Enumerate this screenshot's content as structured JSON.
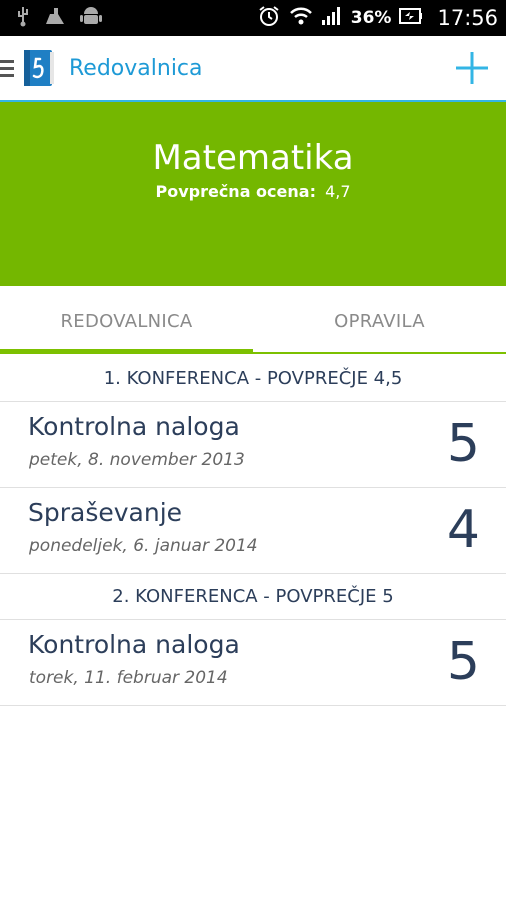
{
  "status_bar": {
    "icons_left": [
      "usb-icon",
      "notification-icon",
      "android-debug-icon"
    ],
    "icons_right": [
      "alarm-icon",
      "wifi-icon",
      "signal-icon",
      "battery-icon"
    ],
    "battery": "36%",
    "time": "17:56"
  },
  "action_bar": {
    "title": "Redovalnica",
    "add_icon": "plus-icon"
  },
  "subject": {
    "name": "Matematika",
    "average_label": "Povprečna ocena:",
    "average_value": "4,7"
  },
  "tabs": [
    {
      "label": "REDOVALNICA",
      "selected": true
    },
    {
      "label": "OPRAVILA",
      "selected": false
    }
  ],
  "sections": [
    {
      "header": "1. KONFERENCA - POVPREČJE 4,5",
      "items": [
        {
          "title": "Kontrolna naloga",
          "date": "petek, 8. november 2013",
          "grade": "5"
        },
        {
          "title": "Spraševanje",
          "date": "ponedeljek, 6. januar 2014",
          "grade": "4"
        }
      ]
    },
    {
      "header": "2. KONFERENCA - POVPREČJE 5",
      "items": [
        {
          "title": "Kontrolna naloga",
          "date": "torek, 11. februar 2014",
          "grade": "5"
        }
      ]
    }
  ],
  "colors": {
    "accent_blue": "#33b5e5",
    "header_green": "#74b700",
    "tab_indicator": "#7cc000",
    "text_dark": "#2c3e5a"
  }
}
